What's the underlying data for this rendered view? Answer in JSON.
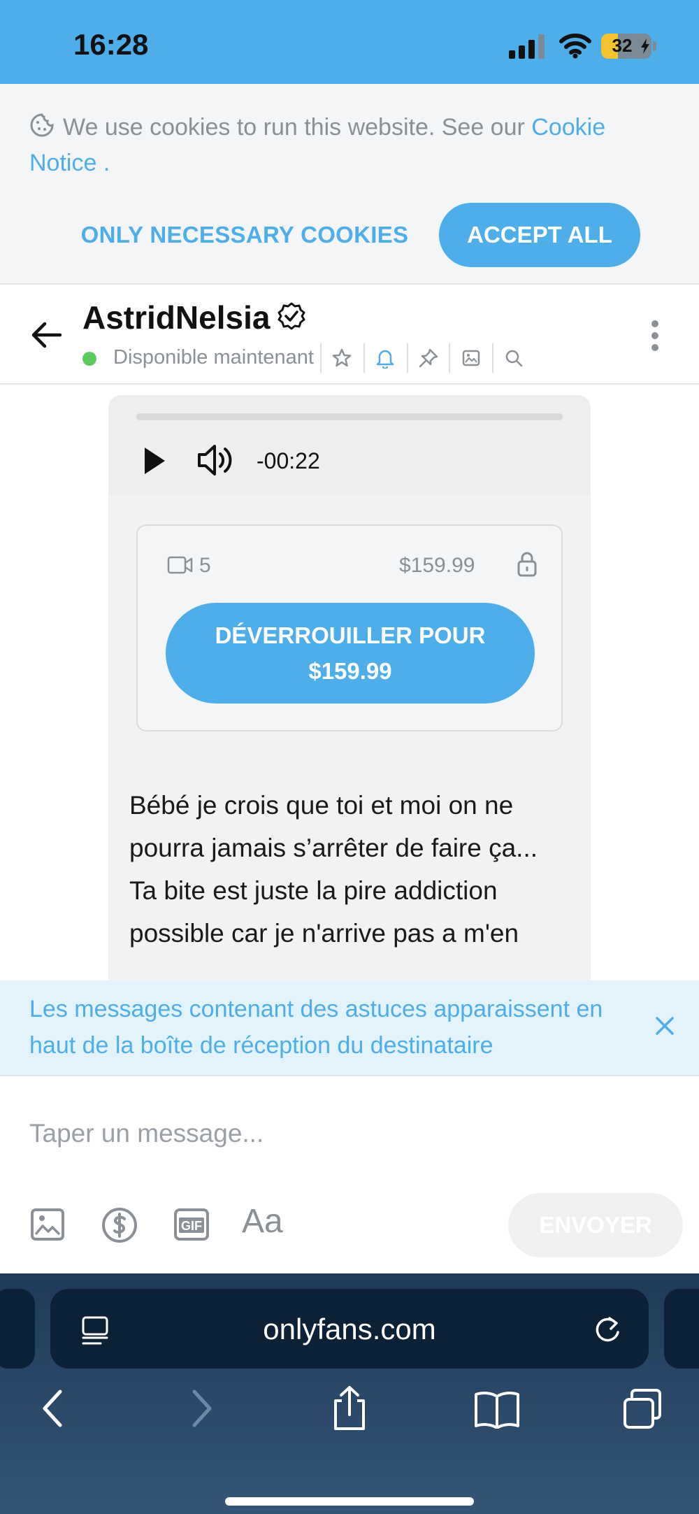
{
  "status_bar": {
    "time": "16:28",
    "battery": "32"
  },
  "cookie_banner": {
    "text": "We use cookies to run this website. See our ",
    "link": "Cookie Notice",
    "suffix": " .",
    "necessary_label": "ONLY NECESSARY COOKIES",
    "accept_label": "ACCEPT ALL"
  },
  "chat_header": {
    "username": "AstridNelsia",
    "status": "Disponible maintenant"
  },
  "message": {
    "audio_time": "-00:22",
    "audio_progress": 0,
    "video_count": "5",
    "price": "$159.99",
    "unlock_label_line1": "DÉVERROUILLER POUR",
    "unlock_label_line2": "$159.99",
    "text": "Bébé je crois que toi et moi on ne pourra jamais s’arrêter de faire ça...\nTa bite est juste la pire addiction possible car je n'arrive pas a m'en"
  },
  "tip_notice": {
    "text": "Les messages contenant des astuces apparaissent en haut de la boîte de réception du destinataire"
  },
  "composer": {
    "placeholder": "Taper un message...",
    "text_tool": "Aa",
    "send_label": "ENVOYER"
  },
  "browser": {
    "url": "onlyfans.com"
  },
  "colors": {
    "accent": "#4eaeea",
    "online": "#5ecb5a",
    "browser_bg": "#1f3a58"
  }
}
